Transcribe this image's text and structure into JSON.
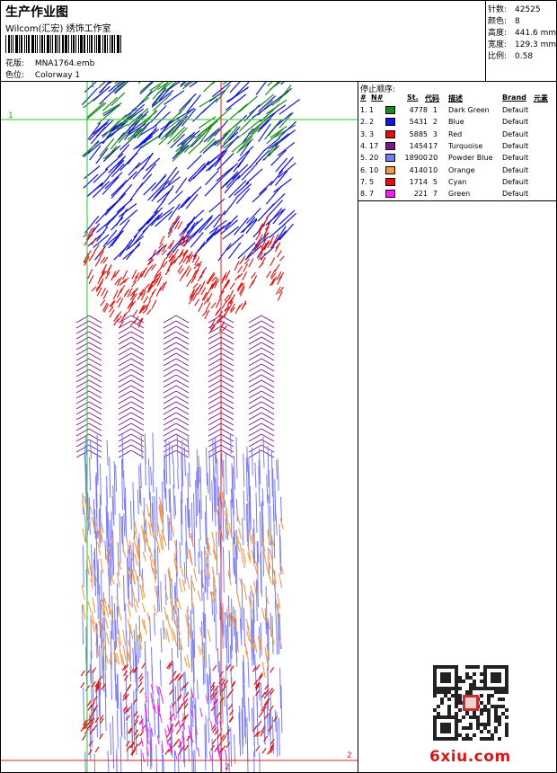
{
  "header": {
    "title": "生产作业图",
    "company": "Wilcom(汇宏) 绣饰工作室",
    "design_label": "花版:",
    "design_value": "MNA1764.emb",
    "colorway_label": "色位:",
    "colorway_value": "Colorway 1"
  },
  "stats": [
    {
      "label": "针数:",
      "value": "42525"
    },
    {
      "label": "颜色:",
      "value": "8"
    },
    {
      "label": "高度:",
      "value": "441.6 mm"
    },
    {
      "label": "宽度:",
      "value": "129.3 mm"
    },
    {
      "label": "比例:",
      "value": "0.58"
    }
  ],
  "canvas": {
    "marker1_top": "1",
    "marker1_left": "1",
    "marker2_bottom": "2",
    "marker2_right": "2"
  },
  "stops": {
    "title": "停止顺序:",
    "headers": {
      "num": "#",
      "n": "N#",
      "st": "St.",
      "code": "代码",
      "desc": "描述",
      "brand": "Brand",
      "element": "元素"
    },
    "rows": [
      {
        "idx": "1.",
        "n": "1",
        "color": "#1a8a1a",
        "st": "4778",
        "code": "1",
        "desc": "Dark Green",
        "brand": "Default"
      },
      {
        "idx": "2.",
        "n": "2",
        "color": "#1515d6",
        "st": "5431",
        "code": "2",
        "desc": "Blue",
        "brand": "Default"
      },
      {
        "idx": "3.",
        "n": "3",
        "color": "#e01010",
        "st": "5885",
        "code": "3",
        "desc": "Red",
        "brand": "Default"
      },
      {
        "idx": "4.",
        "n": "17",
        "color": "#7a1a8a",
        "st": "1454",
        "code": "17",
        "desc": "Turquoise",
        "brand": "Default"
      },
      {
        "idx": "5.",
        "n": "20",
        "color": "#7b7bf0",
        "st": "18900",
        "code": "20",
        "desc": "Powder Blue",
        "brand": "Default"
      },
      {
        "idx": "6.",
        "n": "10",
        "color": "#f09a4a",
        "st": "4140",
        "code": "10",
        "desc": "Orange",
        "brand": "Default"
      },
      {
        "idx": "7.",
        "n": "5",
        "color": "#e01010",
        "st": "1714",
        "code": "5",
        "desc": "Cyan",
        "brand": "Default"
      },
      {
        "idx": "8.",
        "n": "7",
        "color": "#f020f0",
        "st": "221",
        "code": "7",
        "desc": "Green",
        "brand": "Default"
      }
    ]
  },
  "watermark": {
    "site": "6xiu.com"
  }
}
